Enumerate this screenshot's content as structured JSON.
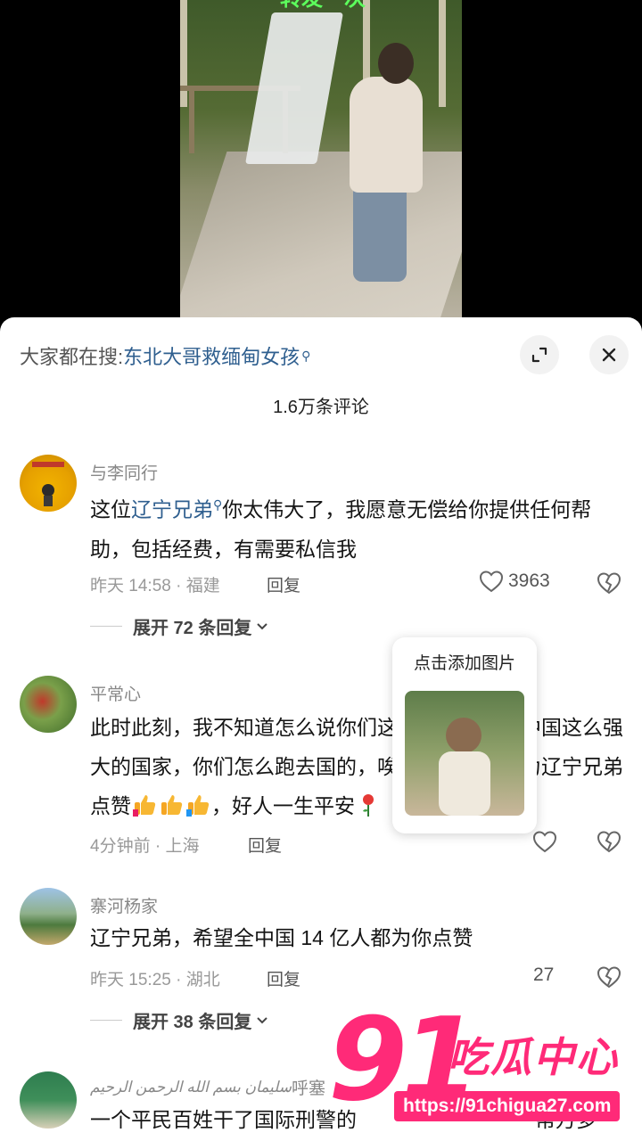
{
  "video": {
    "caption": "转发一次"
  },
  "search": {
    "prefix": "大家都在搜:",
    "term": "东北大哥救缅甸女孩",
    "mag": "⚲"
  },
  "comments_count": "1.6万条评论",
  "comments": [
    {
      "user": "与李同行",
      "text_pre": "这位",
      "text_link": "辽宁兄弟",
      "text_link_mag": "⚲",
      "text_post": "你太伟大了，我愿意无偿给你提供任何帮助，包括经费，有需要私信我",
      "time": "昨天 14:58 · 福建",
      "reply": "回复",
      "likes": "3963",
      "expand": "展开 72 条回复"
    },
    {
      "user": "平常心",
      "text_a": "此时此刻，我不知道怎么说你们这些女孩，我们中国这么强大的国家，你们怎么跑去国的，唉，不过还是要为辽宁兄弟点赞",
      "text_b": "，好人一生平安",
      "time": "4分钟前 · 上海",
      "reply": "回复"
    },
    {
      "user": "寨河杨家",
      "text": "辽宁兄弟，希望全中国 14 亿人都为你点赞",
      "time": "昨天 15:25 · 湖北",
      "reply": "回复",
      "likes": "27",
      "expand": "展开 38 条回复"
    },
    {
      "user_arabic": "سليمان بسم الله الرحمن الرحيم",
      "user": "呼塞",
      "text": "一个平民百姓干了国际刑警的",
      "text_tail": "帮万多"
    }
  ],
  "popup": {
    "label": "点击添加图片"
  },
  "watermark": {
    "number": "91",
    "name": "吃瓜中心",
    "url": "https://91chigua27.com"
  },
  "colors": {
    "link": "#2f5f8f",
    "accent": "#ff2a78"
  }
}
